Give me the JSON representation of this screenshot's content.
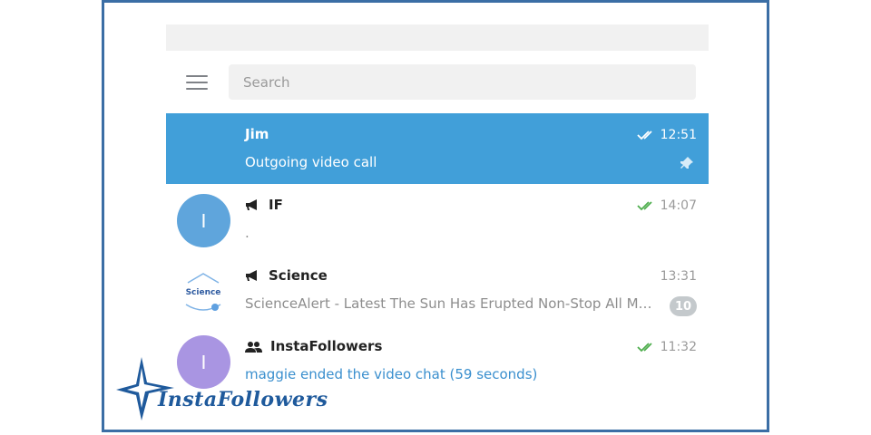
{
  "search": {
    "placeholder": "Search"
  },
  "chats": [
    {
      "name": "Jim",
      "message": "Outgoing video call",
      "time": "12:51",
      "status": "read",
      "pinned": true,
      "active": true
    },
    {
      "name": "IF",
      "avatar_letter": "I",
      "avatar_color": "#5fa5dc",
      "type": "channel",
      "message": ".",
      "time": "14:07",
      "status": "read"
    },
    {
      "name": "Science",
      "avatar_text": "Science",
      "type": "channel",
      "message": "ScienceAlert - Latest The Sun Has Erupted Non-Stop All Mo...",
      "time": "13:31",
      "unread": "10"
    },
    {
      "name": "InstaFollowers",
      "avatar_letter": "I",
      "avatar_color": "#a995e2",
      "type": "group",
      "message": "maggie ended the video chat (59 seconds)",
      "time": "11:32",
      "status": "read"
    }
  ],
  "watermark": {
    "text": "InstaFollowers"
  },
  "colors": {
    "accent": "#419fd9",
    "read_check": "#4fae4e",
    "frame": "#3b6ea5"
  }
}
